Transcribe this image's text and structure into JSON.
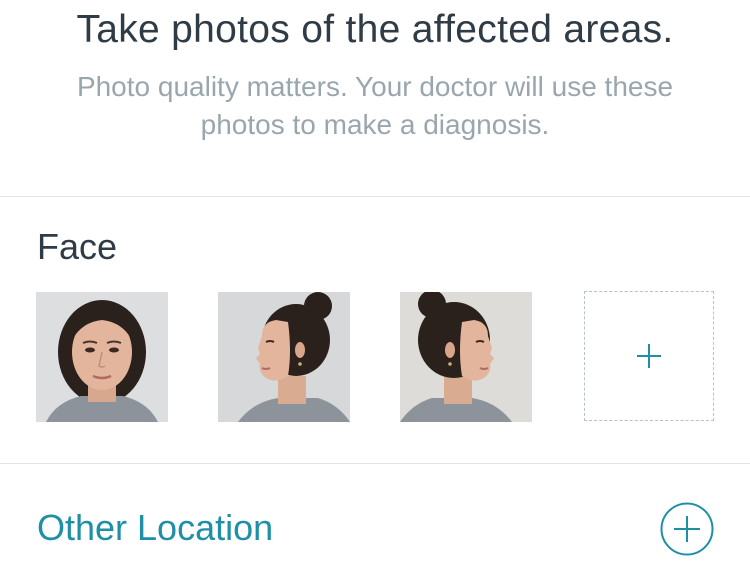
{
  "header": {
    "title": "Take photos of the affected areas.",
    "subtitle": "Photo quality matters. Your doctor will use these photos to make a diagnosis."
  },
  "face_section": {
    "label": "Face",
    "photos": [
      {
        "name": "face-photo-front"
      },
      {
        "name": "face-photo-left-profile"
      },
      {
        "name": "face-photo-right-profile"
      }
    ],
    "add_icon": "plus-icon"
  },
  "other_section": {
    "label": "Other Location",
    "add_icon": "circle-plus-icon"
  },
  "colors": {
    "accent": "#1f8fa6",
    "title": "#2f3b45",
    "subtitle": "#9aa6ae",
    "divider": "#e2e5e8"
  }
}
